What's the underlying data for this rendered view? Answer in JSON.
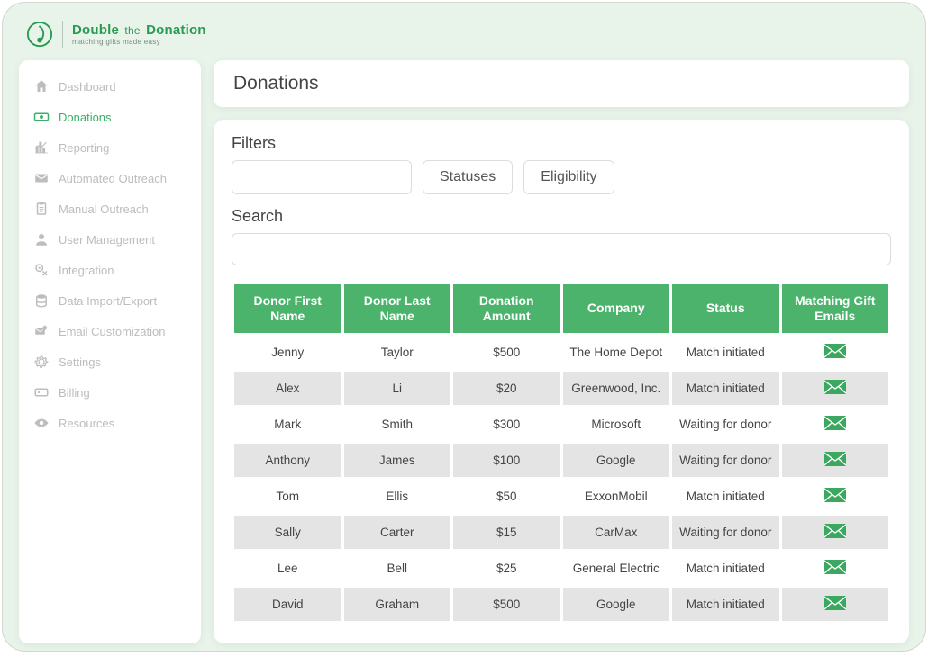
{
  "brand": {
    "name_pre": "Double",
    "name_mid": "the",
    "name_post": "Donation",
    "tagline": "matching gifts made easy"
  },
  "colors": {
    "accent": "#3bb06a",
    "header_bg": "#4bb36b"
  },
  "sidebar": {
    "items": [
      {
        "label": "Dashboard",
        "icon": "home-icon",
        "active": false
      },
      {
        "label": "Donations",
        "icon": "money-icon",
        "active": true
      },
      {
        "label": "Reporting",
        "icon": "chart-icon",
        "active": false
      },
      {
        "label": "Automated Outreach",
        "icon": "envelope-icon",
        "active": false
      },
      {
        "label": "Manual Outreach",
        "icon": "clipboard-icon",
        "active": false
      },
      {
        "label": "User Management",
        "icon": "user-icon",
        "active": false
      },
      {
        "label": "Integration",
        "icon": "gear-link-icon",
        "active": false
      },
      {
        "label": "Data Import/Export",
        "icon": "database-icon",
        "active": false
      },
      {
        "label": "Email Customization",
        "icon": "mail-edit-icon",
        "active": false
      },
      {
        "label": "Settings",
        "icon": "gear-icon",
        "active": false
      },
      {
        "label": "Billing",
        "icon": "card-icon",
        "active": false
      },
      {
        "label": "Resources",
        "icon": "eye-icon",
        "active": false
      }
    ]
  },
  "page": {
    "title": "Donations"
  },
  "filters": {
    "heading": "Filters",
    "statuses_btn": "Statuses",
    "eligibility_btn": "Eligibility",
    "search_heading": "Search",
    "search_value": ""
  },
  "table": {
    "headers": {
      "first": "Donor First Name",
      "last": "Donor Last Name",
      "amount": "Donation Amount",
      "company": "Company",
      "status": "Status",
      "emails": "Matching Gift Emails"
    },
    "rows": [
      {
        "first": "Jenny",
        "last": "Taylor",
        "amount": "$500",
        "company": "The Home Depot",
        "status": "Match initiated"
      },
      {
        "first": "Alex",
        "last": "Li",
        "amount": "$20",
        "company": "Greenwood, Inc.",
        "status": "Match initiated"
      },
      {
        "first": "Mark",
        "last": "Smith",
        "amount": "$300",
        "company": "Microsoft",
        "status": "Waiting for donor"
      },
      {
        "first": "Anthony",
        "last": "James",
        "amount": "$100",
        "company": "Google",
        "status": "Waiting for donor"
      },
      {
        "first": "Tom",
        "last": "Ellis",
        "amount": "$50",
        "company": "ExxonMobil",
        "status": "Match initiated"
      },
      {
        "first": "Sally",
        "last": "Carter",
        "amount": "$15",
        "company": "CarMax",
        "status": "Waiting for donor"
      },
      {
        "first": "Lee",
        "last": "Bell",
        "amount": "$25",
        "company": "General Electric",
        "status": "Match initiated"
      },
      {
        "first": "David",
        "last": "Graham",
        "amount": "$500",
        "company": "Google",
        "status": "Match initiated"
      }
    ]
  }
}
